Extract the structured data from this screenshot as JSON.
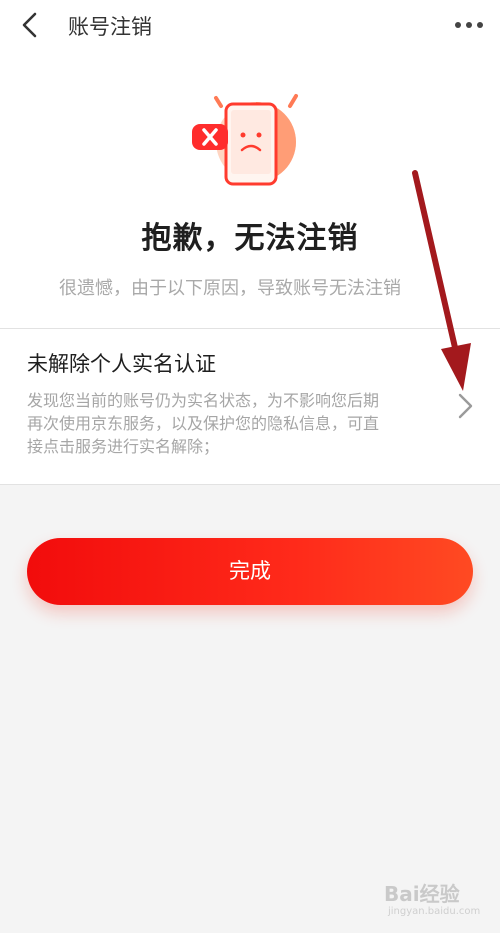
{
  "header": {
    "title": "账号注销",
    "back_icon": "chevron-left-icon",
    "more_icon": "more-dots-icon"
  },
  "status": {
    "illustration": "phone-error-illustration",
    "headline": "抱歉，无法注销",
    "subline": "很遗憾，由于以下原因，导致账号无法注销"
  },
  "reason": {
    "title": "未解除个人实名认证",
    "description": "发现您当前的账号仍为实名状态，为不影响您后期再次使用京东服务，以及保护您的隐私信息，可直接点击服务进行实名解除；",
    "chevron_icon": "chevron-right-icon"
  },
  "actions": {
    "done_label": "完成"
  },
  "watermark": {
    "text": "Bai经验",
    "sub": "jingyan.baidu.com"
  },
  "colors": {
    "accent": "#f21c0f",
    "annotation_arrow": "#a3191d"
  }
}
